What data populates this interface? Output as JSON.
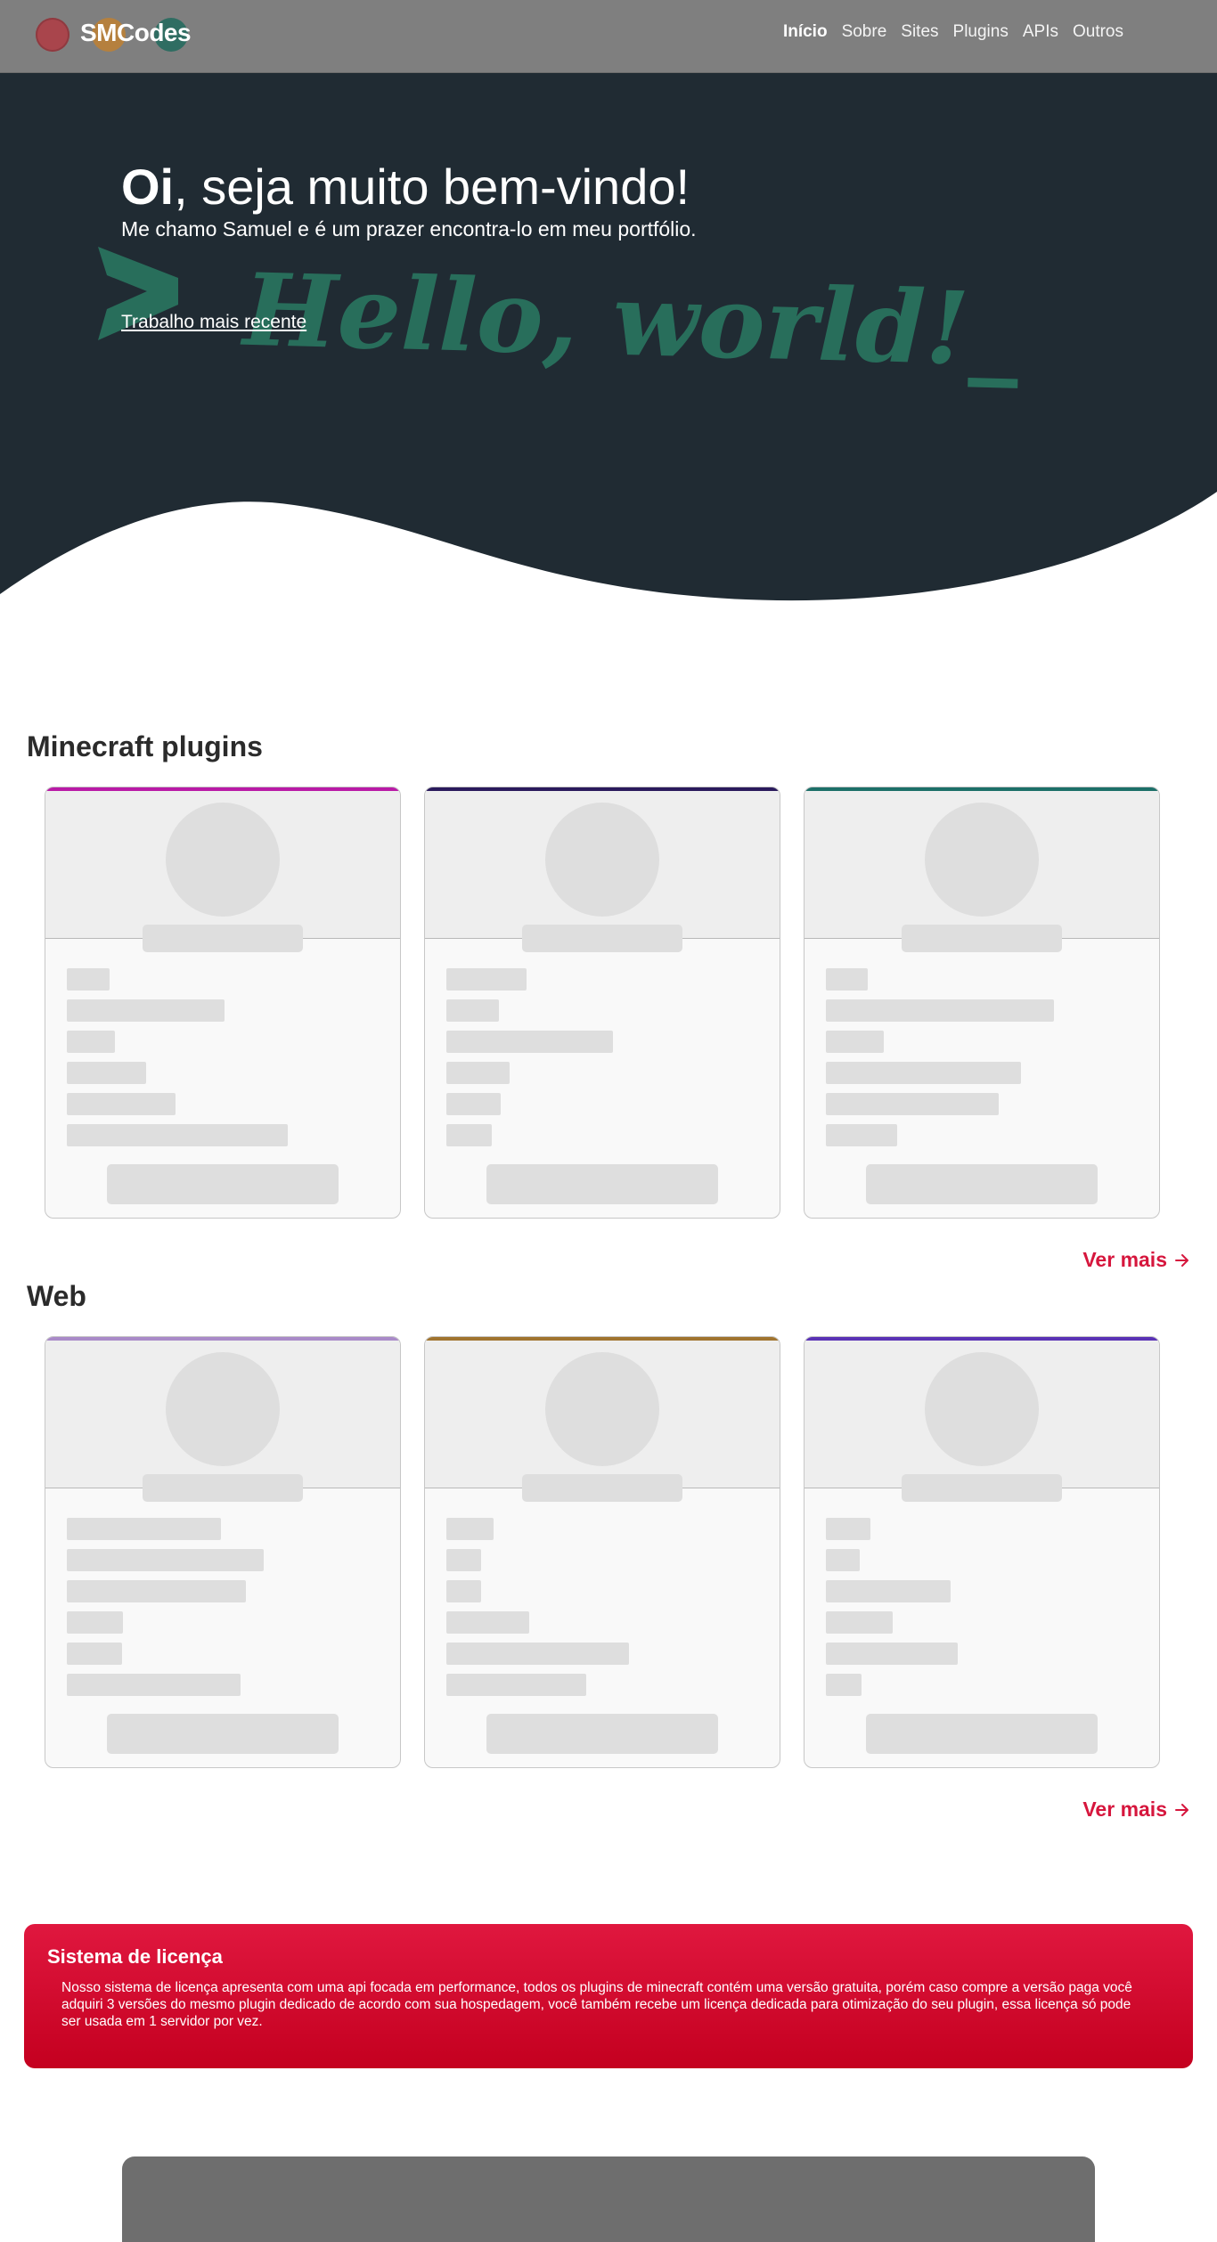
{
  "navbar": {
    "brand": "SMCodes",
    "links": [
      "Início",
      "Sobre",
      "Sites",
      "Plugins",
      "APIs",
      "Outros"
    ],
    "active_index": 0
  },
  "hero": {
    "title_bold": "Oi",
    "title_rest": ", seja muito bem-vindo!",
    "subtitle": "Me chamo Samuel e é um prazer encontra-lo em meu portfólio.",
    "cta": "Trabalho mais recente",
    "watermark_text": "Hello, world!_"
  },
  "sections": [
    {
      "title": "Minecraft plugins",
      "more": "Ver mais",
      "card_accents": [
        "#b91aa6",
        "#2a1a5c",
        "#1c6f68"
      ]
    },
    {
      "title": "Web",
      "more": "Ver mais",
      "card_accents": [
        "#a98ac8",
        "#a0742f",
        "#5a32b5"
      ]
    }
  ],
  "license": {
    "title": "Sistema de licença",
    "body": "Nosso sistema de licença apresenta com uma api focada em performance, todos os plugins de minecraft contém uma versão gratuita, porém caso compre a versão paga você adquiri 3 versões do mesmo plugin dedicado de acordo com sua hospedagem, você também recebe um licença dedicada para otimização do seu plugin, essa licença só pode ser usada em 1 servidor por vez."
  },
  "colors": {
    "accent": "#d6163d",
    "hero_bg": "#202b33",
    "navbar_bg": "#7f7f7f",
    "watermark": "#2a7a63"
  }
}
